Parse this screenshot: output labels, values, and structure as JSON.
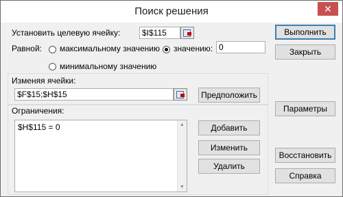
{
  "window": {
    "title": "Поиск решения",
    "close_glyph": "✕"
  },
  "target": {
    "label": "Установить целевую ячейку:",
    "value": "$I$115"
  },
  "equal": {
    "label": "Равной:",
    "max_label": "максимальному значению",
    "value_label": "значению:",
    "value": "0",
    "min_label": "минимальному значению",
    "selected": "value"
  },
  "changing": {
    "label": "Изменяя ячейки:",
    "value": "$F$15;$H$15",
    "guess_label": "Предположить"
  },
  "constraints": {
    "label": "Ограничения:",
    "items": [
      "$H$115 = 0"
    ],
    "add_label": "Добавить",
    "change_label": "Изменить",
    "delete_label": "Удалить"
  },
  "side": {
    "run_label": "Выполнить",
    "close_label": "Закрыть",
    "params_label": "Параметры",
    "restore_label": "Восстановить",
    "help_label": "Справка"
  },
  "icons": {
    "ref": "range-select-icon",
    "close": "close-icon"
  }
}
